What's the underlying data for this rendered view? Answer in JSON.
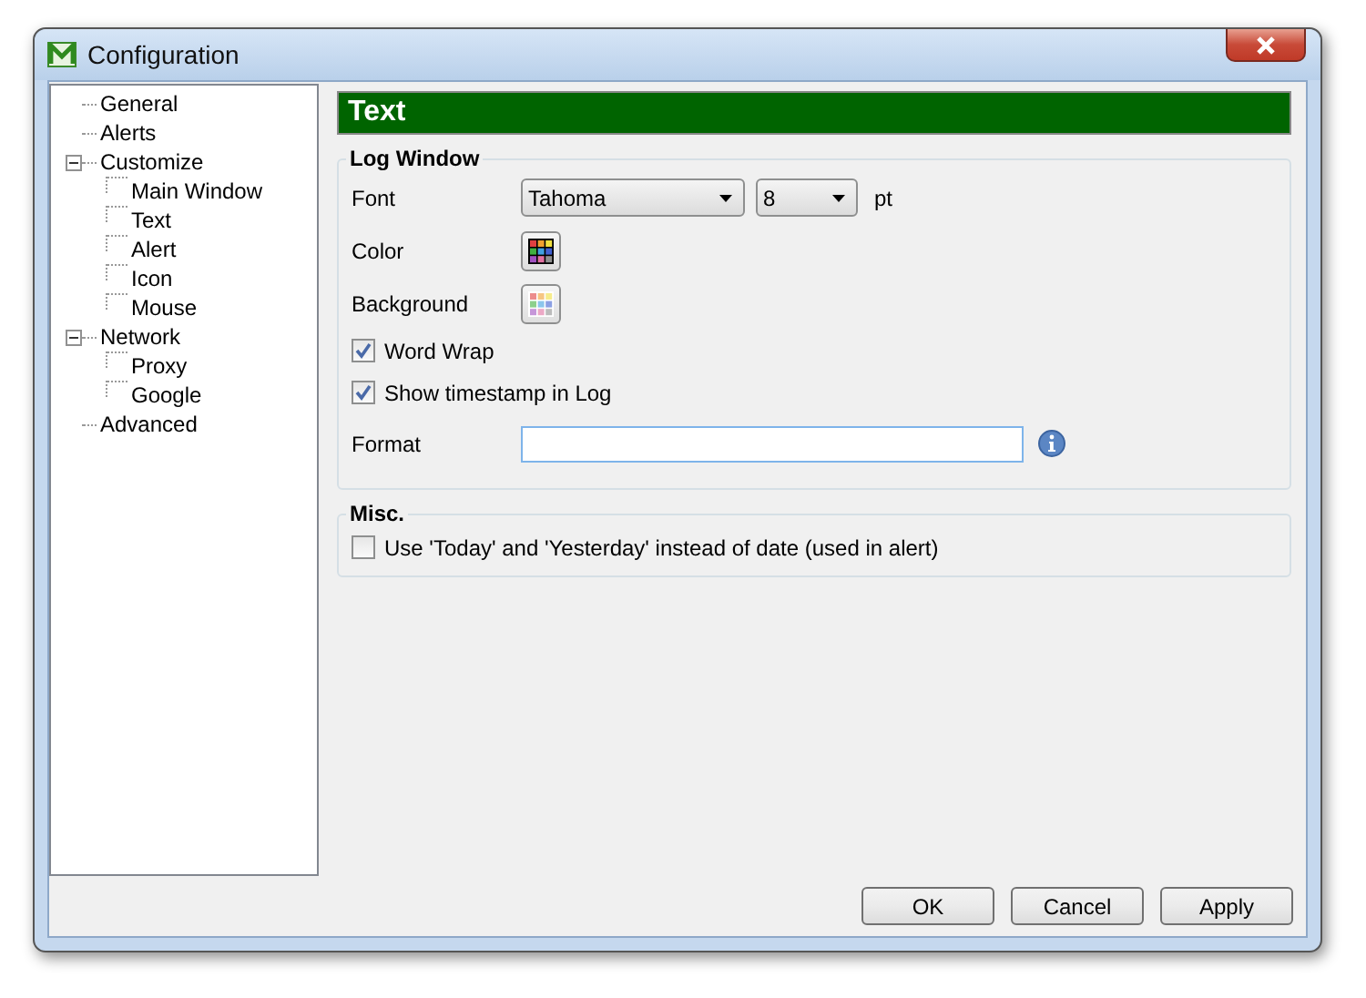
{
  "window": {
    "title": "Configuration"
  },
  "tree": [
    {
      "label": "General"
    },
    {
      "label": "Alerts"
    },
    {
      "label": "Customize",
      "expanded": true,
      "children": [
        {
          "label": "Main Window"
        },
        {
          "label": "Text"
        },
        {
          "label": "Alert"
        },
        {
          "label": "Icon"
        },
        {
          "label": "Mouse"
        }
      ]
    },
    {
      "label": "Network",
      "expanded": true,
      "children": [
        {
          "label": "Proxy"
        },
        {
          "label": "Google"
        }
      ]
    },
    {
      "label": "Advanced"
    }
  ],
  "page_title": "Text",
  "log_window": {
    "title": "Log Window",
    "font_label": "Font",
    "font": "Tahoma",
    "size": "8",
    "unit": "pt",
    "color_label": "Color",
    "background_label": "Background",
    "checkboxes": [
      {
        "label": "Word Wrap",
        "checked": true
      },
      {
        "label": "Show timestamp in Log",
        "checked": true
      }
    ],
    "format_label": "Format"
  },
  "misc": {
    "title": "Misc.",
    "checkboxes": [
      {
        "label": "Use 'Today' and 'Yesterday' instead of date (used in alert)",
        "checked": false
      }
    ]
  },
  "buttons": [
    "OK",
    "Cancel",
    "Apply"
  ]
}
